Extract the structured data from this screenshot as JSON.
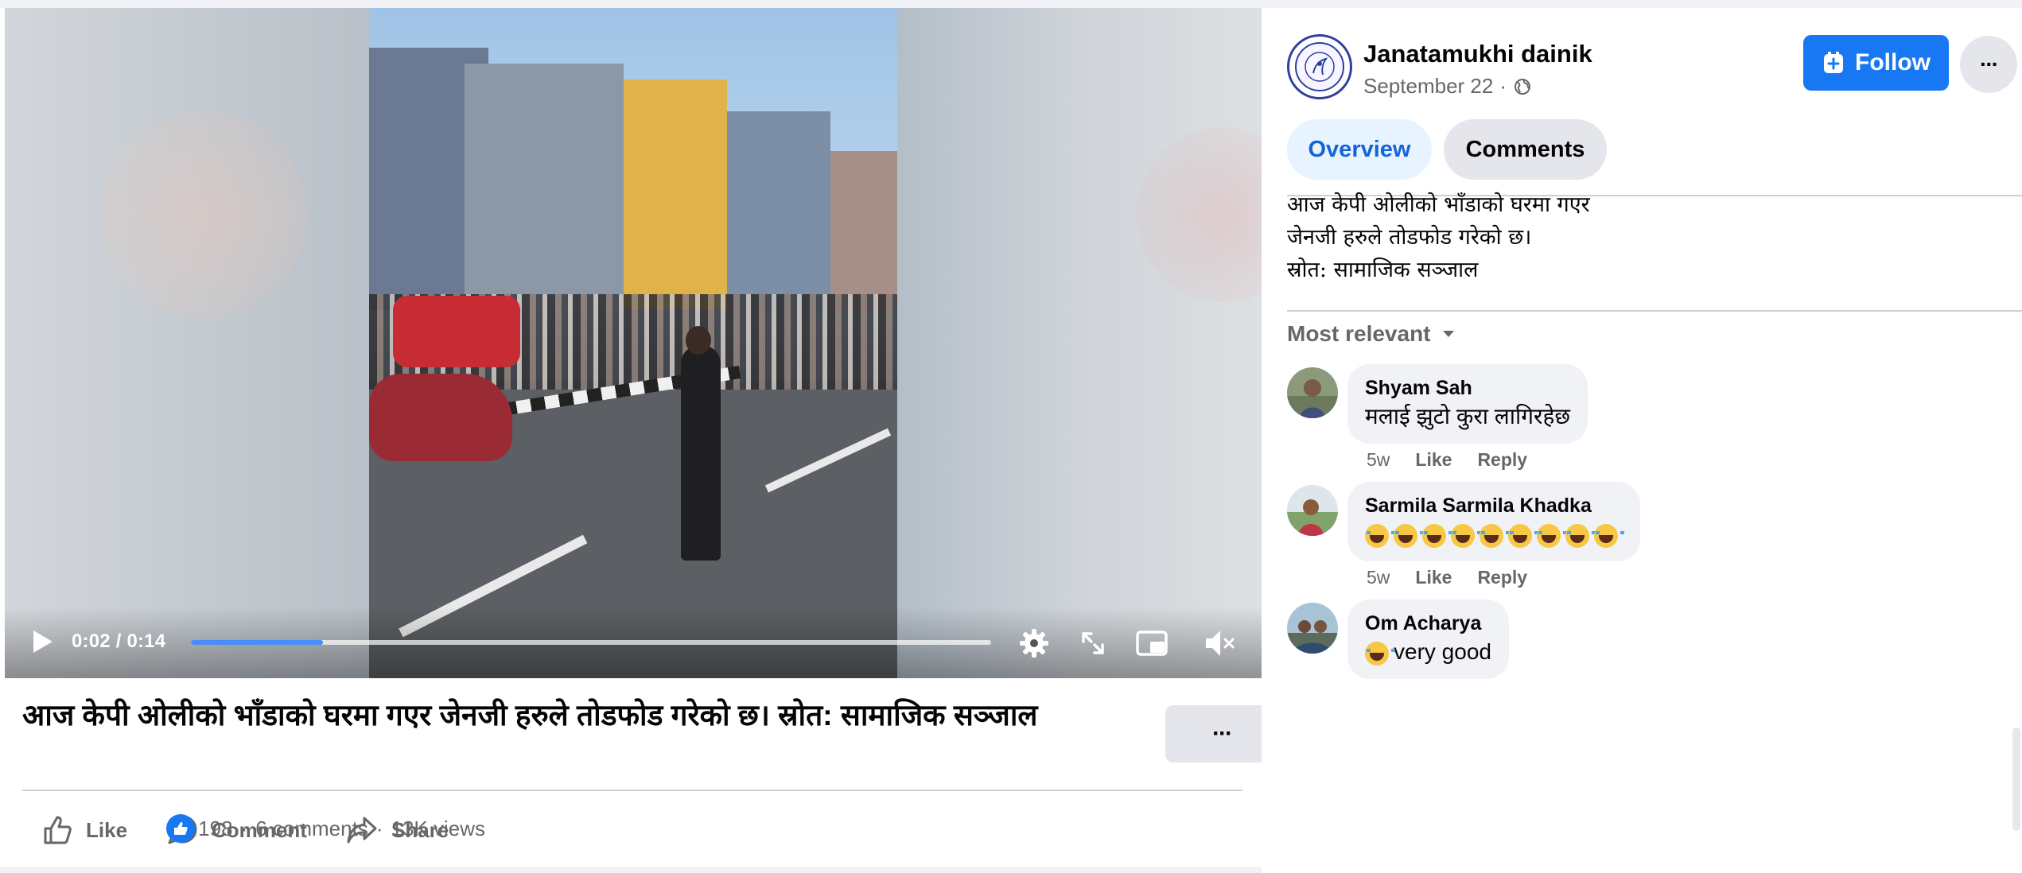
{
  "video": {
    "time": "0:02 / 0:14",
    "progress_fraction": 0.165
  },
  "post": {
    "title": "आज केपी ओलीको भाँडाको घरमा गएर जेनजी हरुले तोडफोड गरेको छ। स्रोत: सामाजिक सञ्जाल",
    "more_label": "···",
    "actions": {
      "like": "Like",
      "comment": "Comment",
      "share": "Share"
    },
    "stats": {
      "reactions": "198",
      "comments": "6 comments",
      "views": "13K views",
      "separator": "·"
    }
  },
  "page": {
    "name": "Janatamukhi dainik",
    "date": "September 22",
    "date_separator": "·",
    "follow_label": "Follow",
    "more_label": "···"
  },
  "tabs": [
    {
      "label": "Overview",
      "active": true
    },
    {
      "label": "Comments",
      "active": false
    }
  ],
  "description": [
    "आज केपी ओलीको भाँडाको घरमा गएर",
    "जेनजी हरुले तोडफोड गरेको छ।",
    "स्रोत: सामाजिक सञ्जाल"
  ],
  "comments_sort": "Most relevant",
  "comments": [
    {
      "name": "Shyam Sah",
      "text": "मलाई झुटो कुरा लागिरहेछ",
      "emoji_count": 0,
      "age": "5w",
      "like": "Like",
      "reply": "Reply"
    },
    {
      "name": "Sarmila Sarmila Khadka",
      "text": "",
      "emoji_count": 9,
      "emoji_name": "tears-of-joy-emoji",
      "age": "5w",
      "like": "Like",
      "reply": "Reply"
    },
    {
      "name": "Om Acharya",
      "text": "very good",
      "emoji_count": 1,
      "emoji_name": "tears-of-joy-emoji"
    }
  ],
  "colors": {
    "brand_blue": "#1877f2",
    "secondary_text": "#65676b",
    "bubble_bg": "#f0f2f5"
  }
}
